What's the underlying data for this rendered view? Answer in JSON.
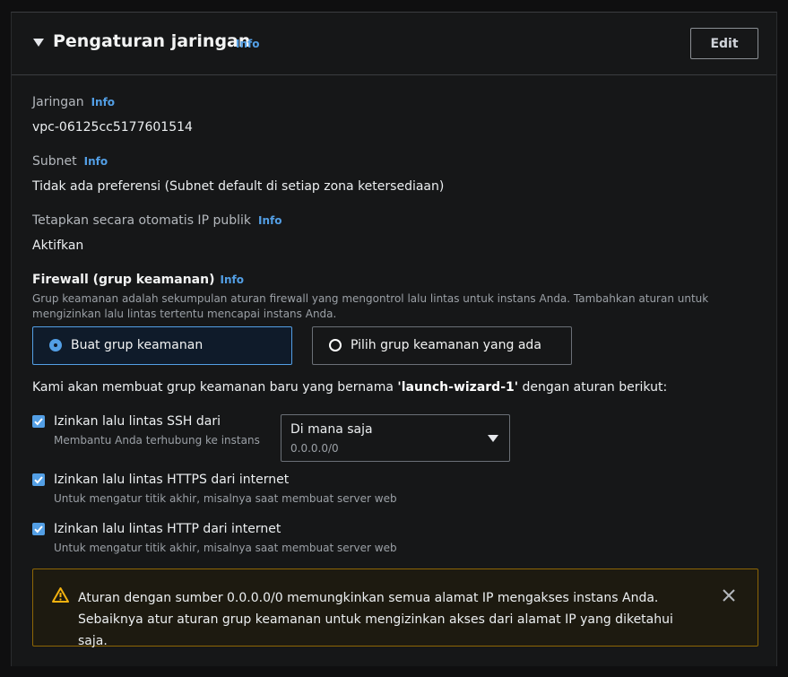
{
  "section": {
    "title": "Pengaturan jaringan",
    "info": "Info",
    "edit_label": "Edit"
  },
  "network": {
    "label": "Jaringan",
    "info": "Info",
    "value": "vpc-06125cc5177601514"
  },
  "subnet": {
    "label": "Subnet",
    "info": "Info",
    "value": "Tidak ada preferensi (Subnet default di setiap zona ketersediaan)"
  },
  "public_ip": {
    "label": "Tetapkan secara otomatis IP publik",
    "info": "Info",
    "value": "Aktifkan"
  },
  "firewall": {
    "title": "Firewall (grup keamanan)",
    "info": "Info",
    "description": "Grup keamanan adalah sekumpulan aturan firewall yang mengontrol lalu lintas untuk instans Anda. Tambahkan aturan untuk mengizinkan lalu lintas tertentu mencapai instans Anda.",
    "options": [
      {
        "label": "Buat grup keamanan",
        "selected": true
      },
      {
        "label": "Pilih grup keamanan yang ada",
        "selected": false
      }
    ],
    "notice_prefix": "Kami akan membuat grup keamanan baru yang bernama ",
    "notice_name": "'launch-wizard-1'",
    "notice_suffix": " dengan aturan berikut:"
  },
  "rules": [
    {
      "title": "Izinkan lalu lintas SSH dari",
      "description": "Membantu Anda terhubung ke instans",
      "checked": true
    },
    {
      "title": "Izinkan lalu lintas HTTPS dari internet",
      "description": "Untuk mengatur titik akhir, misalnya saat membuat server web",
      "checked": true
    },
    {
      "title": "Izinkan lalu lintas HTTP dari internet",
      "description": "Untuk mengatur titik akhir, misalnya saat membuat server web",
      "checked": true
    }
  ],
  "ssh_source": {
    "value": "Di mana saja",
    "cidr": "0.0.0.0/0"
  },
  "warning": {
    "line1": "Aturan dengan sumber 0.0.0.0/0 memungkinkan semua alamat IP mengakses instans Anda.",
    "line2": "Sebaiknya atur aturan grup keamanan untuk mengizinkan akses dari alamat IP yang diketahui saja."
  },
  "colors": {
    "accent": "#539fe5",
    "warning_border": "#8d6605",
    "warning_icon": "#f2b10f"
  }
}
